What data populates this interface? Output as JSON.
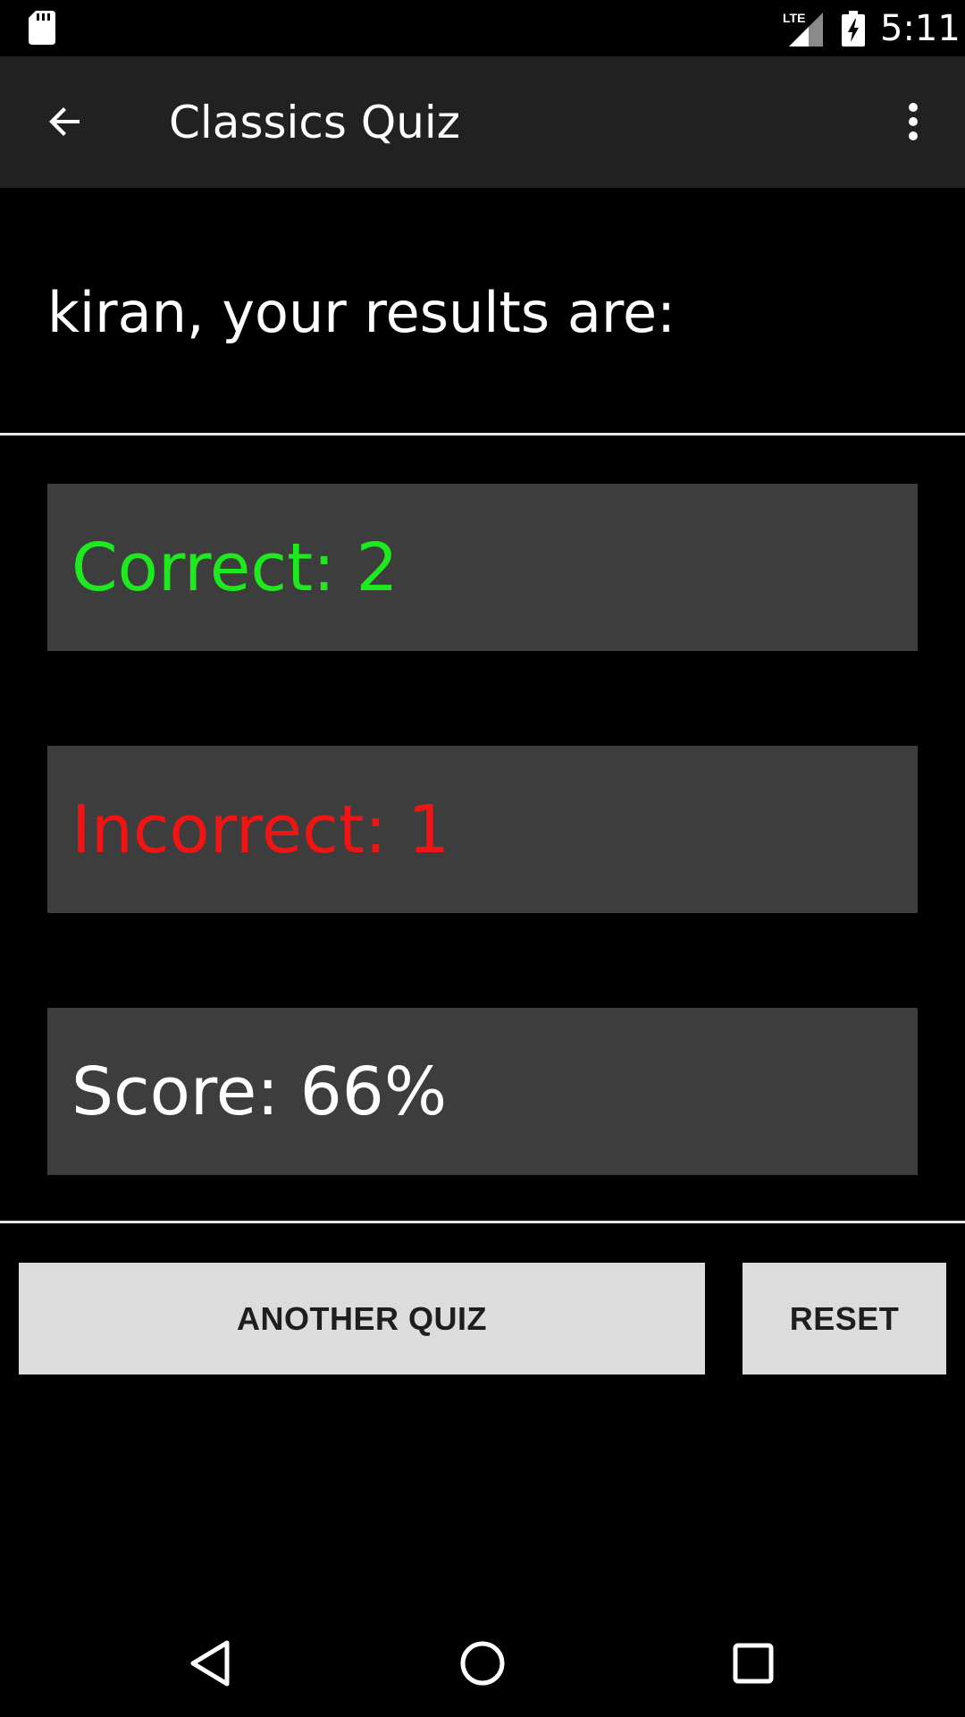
{
  "status_bar": {
    "time": "5:11",
    "network_label": "LTE",
    "icons": [
      "sd-card-icon",
      "lte-signal-icon",
      "battery-charging-icon"
    ]
  },
  "app_bar": {
    "title": "Classics Quiz",
    "back_icon": "arrow-left-icon",
    "overflow_icon": "more-vert-icon"
  },
  "results": {
    "heading": "kiran, your results are:",
    "correct": "Correct: 2",
    "incorrect": "Incorrect: 1",
    "score": "Score: 66%"
  },
  "buttons": {
    "another_quiz": "ANOTHER QUIZ",
    "reset": "RESET"
  },
  "colors": {
    "correct_text": "#1ee81e",
    "incorrect_text": "#f01414",
    "score_text": "#ffffff",
    "panel_background": "#3d3d3d",
    "app_bar_background": "#212121",
    "button_background": "#dcdcdc"
  },
  "nav_bar": {
    "icons": [
      "nav-back-icon",
      "nav-home-icon",
      "nav-recents-icon"
    ]
  }
}
